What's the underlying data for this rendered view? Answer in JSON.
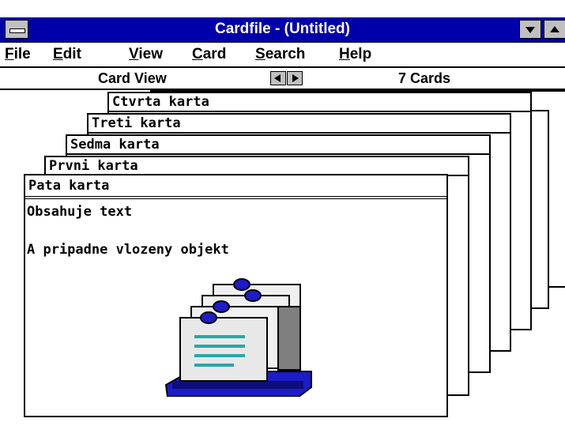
{
  "window": {
    "title": "Cardfile - (Untitled)"
  },
  "menu": [
    "File",
    "Edit",
    "View",
    "Card",
    "Search",
    "Help"
  ],
  "status": {
    "mode": "Card View",
    "count": "7 Cards"
  },
  "cards": {
    "back": [
      "Ctvrta karta",
      "Treti karta",
      "Sedma karta",
      "Prvni karta"
    ],
    "front": {
      "title": "Pata karta",
      "line1": "Obsahuje text",
      "line2": "A pripadne vlozeny objekt",
      "object_icon": "cardfile-icon"
    }
  },
  "colors": {
    "title_bar": "#0000aa",
    "icon_blue": "#1c1cc8",
    "icon_teal": "#2aa6a6"
  }
}
